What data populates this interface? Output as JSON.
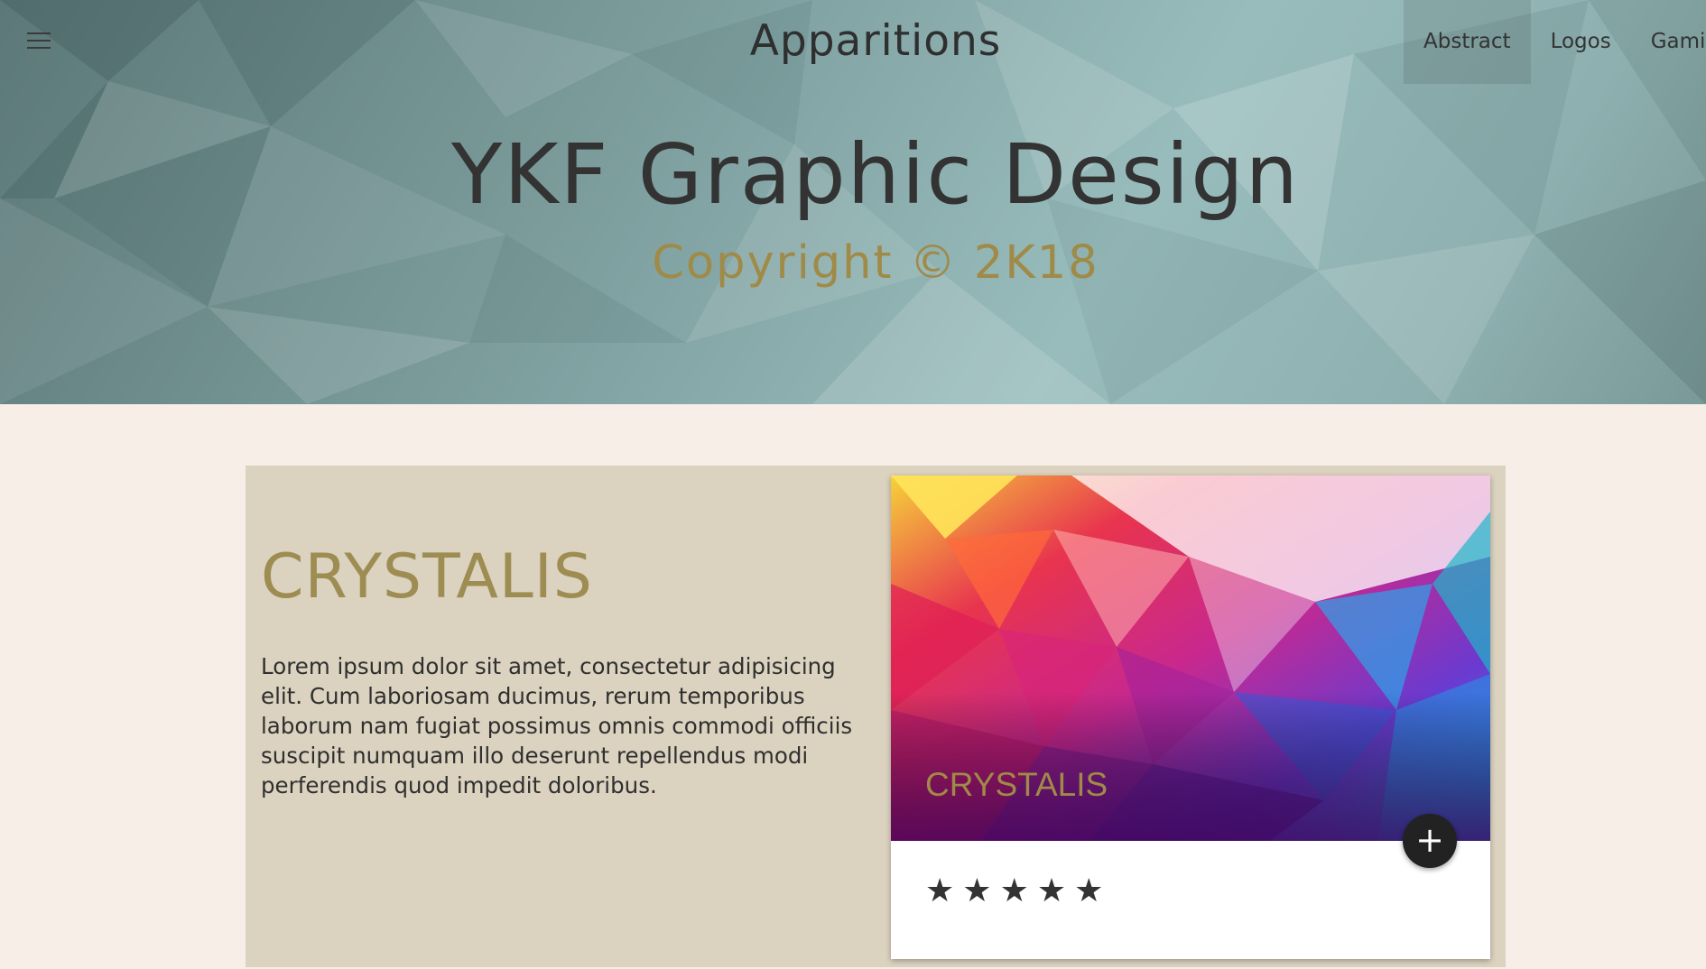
{
  "header": {
    "menu_icon": "hamburger-menu-icon",
    "brand": "Apparitions",
    "nav": [
      {
        "label": "Abstract",
        "active": true
      },
      {
        "label": "Logos",
        "active": false
      },
      {
        "label": "Gami",
        "active": false
      }
    ]
  },
  "hero": {
    "title": "YKF Graphic Design",
    "subtitle": "Copyright © 2K18"
  },
  "section": {
    "title": "CRYSTALIS",
    "body": "Lorem ipsum dolor sit amet, consectetur adipisicing elit. Cum laboriosam ducimus, rerum temporibus laborum nam fugiat possimus omnis commodi officiis suscipit numquam illo deserunt repellendus modi perferendis quod impedit doloribus."
  },
  "card": {
    "caption": "CRYSTALIS",
    "fab_icon": "plus-icon",
    "fab_label": "+",
    "rating": {
      "value": 5,
      "max": 5,
      "star": "★"
    }
  },
  "colors": {
    "page_bg": "#f7eee8",
    "section_bg": "#dbd2bf",
    "gold": "#a08a47",
    "text_dark": "#333333"
  }
}
